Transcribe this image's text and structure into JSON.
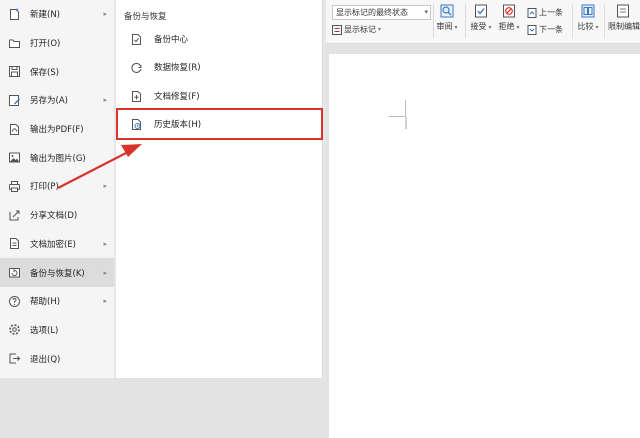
{
  "file_menu": {
    "items": [
      {
        "label": "新建(N)",
        "icon": "new-document-icon",
        "has_submenu": true
      },
      {
        "label": "打开(O)",
        "icon": "folder-icon",
        "has_submenu": false
      },
      {
        "label": "保存(S)",
        "icon": "save-icon",
        "has_submenu": false
      },
      {
        "label": "另存为(A)",
        "icon": "save-as-icon",
        "has_submenu": true
      },
      {
        "label": "输出为PDF(F)",
        "icon": "pdf-icon",
        "has_submenu": false
      },
      {
        "label": "输出为图片(G)",
        "icon": "image-icon",
        "has_submenu": false
      },
      {
        "label": "打印(P)",
        "icon": "printer-icon",
        "has_submenu": true
      },
      {
        "label": "分享文档(D)",
        "icon": "share-icon",
        "has_submenu": false
      },
      {
        "label": "文档加密(E)",
        "icon": "encrypt-icon",
        "has_submenu": true
      },
      {
        "label": "备份与恢复(K)",
        "icon": "backup-icon",
        "has_submenu": true,
        "active": true
      },
      {
        "label": "帮助(H)",
        "icon": "help-icon",
        "has_submenu": true
      },
      {
        "label": "选项(L)",
        "icon": "gear-icon",
        "has_submenu": false
      },
      {
        "label": "退出(Q)",
        "icon": "exit-icon",
        "has_submenu": false
      }
    ]
  },
  "submenu": {
    "title": "备份与恢复",
    "items": [
      {
        "label": "备份中心",
        "icon": "backup-center-icon"
      },
      {
        "label": "数据恢复(R)",
        "icon": "data-recovery-icon"
      },
      {
        "label": "文档修复(F)",
        "icon": "document-repair-icon"
      },
      {
        "label": "历史版本(H)",
        "icon": "history-version-icon",
        "highlighted": true
      }
    ]
  },
  "ribbon": {
    "markup_select": "显示标记的最终状态",
    "show_markup": "显示标记",
    "review": "审阅",
    "accept": "接受",
    "reject": "拒绝",
    "previous": "上一条",
    "next": "下一条",
    "compare": "比较",
    "restrict_editing": "限制编辑"
  },
  "colors": {
    "highlight": "#d9342b",
    "arrow": "#d9342b",
    "menu_bg": "#f5f5f5",
    "active_item_bg": "#dcdcdc"
  }
}
